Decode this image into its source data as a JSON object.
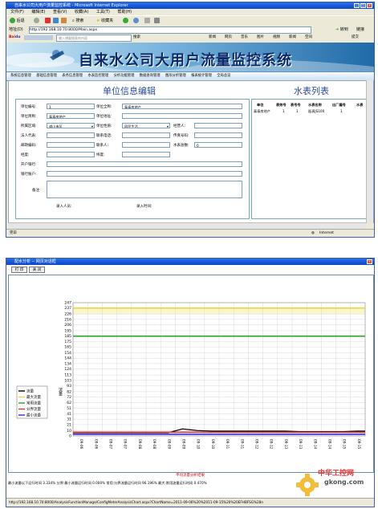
{
  "ie": {
    "title": "自来水公司大用户流量监控系统 - Microsoft Internet Explorer",
    "menu": [
      "文件(F)",
      "编辑(E)",
      "查看(V)",
      "收藏(A)",
      "工具(T)",
      "帮助(H)"
    ],
    "toolbar": {
      "back": "后退",
      "search": "搜索",
      "favorites": "收藏夹"
    },
    "address_label": "地址(D)",
    "address_value": "http://192.168.10.70:8000/Main.aspx",
    "go_label": "转到",
    "links_label": "链接",
    "search_placeholder": "输入想要搜索的内容",
    "links_bar": [
      "搜索",
      "新闻",
      "网页",
      "音乐",
      "图片",
      "视频",
      "新闻",
      "空间",
      "提交"
    ],
    "banner_title": "自来水公司大用户流量监控系统",
    "nav": [
      "系统信息管理",
      "基础信息管理",
      "表务信息管理",
      "水表监控管理",
      "分析功能管理",
      "数据查询管理",
      "图形分析管理",
      "报表统计管理",
      "全局总览"
    ],
    "unit_title": "单位信息编辑",
    "meter_title": "水表列表",
    "form": {
      "unit_no_label": "单位编号:",
      "unit_no": "1",
      "unit_full_label": "单位全称:",
      "unit_full": "泰泰房地产",
      "unit_short_label": "单位简称:",
      "unit_short": "泰泰房地产",
      "unit_addr_label": "单位地址:",
      "district_label": "所属区域:",
      "district": "道山市区",
      "unit_type_label": "单位性质:",
      "unit_type": "居民生活",
      "contact_label": "经营人:",
      "legal_label": "法人代表:",
      "phone_label": "联系电话:",
      "fax_label": "传真号码:",
      "postcode_label": "邮政编码:",
      "contact_person_label": "联系人:",
      "meter_total_label": "水表总数:",
      "meter_total": "0",
      "longitude_label": "经度:",
      "latitude_label": "纬度:",
      "bank_label": "开户银行:",
      "account_label": "银行账户:",
      "remark_label": "备注:",
      "entry_person_label": "录入人员:",
      "entry_time_label": "录入时间:"
    },
    "meter_cols": [
      "单位",
      "表效号",
      "表号号",
      "水表名称",
      "出厂编号",
      "水表"
    ],
    "meter_row": [
      "泰泰房地产",
      "1",
      "1",
      "瓯表JS100",
      "1",
      ""
    ],
    "status_left": "完毕",
    "status_right": "Internet"
  },
  "chart_window": {
    "title": "配水分析 -- 网页对话框",
    "print_label": "打 印",
    "close_label": "关 闭",
    "footer_title": "平均流量分析结果",
    "footer_text": "最小流量以下运行时间 3.334%    分界:最小流量运行时间 0.000%    常用:分界流量运行时间 96.196%    最大:常用流量运行时间 0.470%",
    "status_url": "http://192.168.10.70:8000/AnalysisFunctionManage/ConfigMeterAnalysisChart.aspx?ChartName=2011-09-06%20%2011-09-15%20%20EFHBFSG%28n"
  },
  "chart_data": {
    "type": "line",
    "ylim": [
      0,
      247
    ],
    "yticks": [
      0,
      10,
      21,
      31,
      41,
      51,
      62,
      72,
      82,
      93,
      103,
      113,
      124,
      134,
      144,
      154,
      165,
      175,
      185,
      195,
      206,
      216,
      226,
      237,
      247
    ],
    "xticks": [
      "09-06",
      "09-06",
      "09-07",
      "09-07",
      "09-08",
      "09-08",
      "09-09",
      "09-09",
      "09-10",
      "09-10",
      "09-11",
      "09-11",
      "09-12",
      "09-12",
      "09-13",
      "09-13",
      "09-14",
      "09-14",
      "09-15",
      "09-15"
    ],
    "ylabel": "流量",
    "grid": true,
    "legend_position": "left",
    "series": [
      {
        "name": "流量",
        "color": "#000000",
        "values": [
          6,
          6,
          6,
          6,
          6,
          6,
          6,
          13,
          10,
          9,
          9,
          9,
          9,
          9,
          9,
          8,
          8,
          8,
          8,
          9
        ]
      },
      {
        "name": "最大流量",
        "color": "#e8d34a",
        "values": [
          237,
          237,
          237,
          237,
          237,
          237,
          237,
          237,
          237,
          237,
          237,
          237,
          237,
          237,
          237,
          237,
          237,
          237,
          237,
          237
        ]
      },
      {
        "name": "常用流量",
        "color": "#2aa52a",
        "values": [
          185,
          185,
          185,
          185,
          185,
          185,
          185,
          185,
          185,
          185,
          185,
          185,
          185,
          185,
          185,
          185,
          185,
          185,
          185,
          185
        ]
      },
      {
        "name": "分界流量",
        "color": "#e03030",
        "values": [
          7,
          7,
          7,
          7,
          7,
          7,
          7,
          7,
          7,
          7,
          7,
          7,
          7,
          7,
          7,
          7,
          7,
          7,
          7,
          7
        ]
      },
      {
        "name": "最小流量",
        "color": "#3030d0",
        "values": [
          3,
          3,
          3,
          3,
          3,
          3,
          3,
          3,
          3,
          3,
          3,
          3,
          3,
          3,
          3,
          3,
          3,
          3,
          3,
          3
        ]
      }
    ],
    "band_color": "#fbf6c8",
    "band_range": [
      226,
      237
    ]
  },
  "watermark": {
    "brand": "中华工控网",
    "url": "gkong.com"
  },
  "colors": {
    "titlebar": "#0a46c8",
    "accent": "#2a4a9a",
    "warn": "#cc0000"
  }
}
